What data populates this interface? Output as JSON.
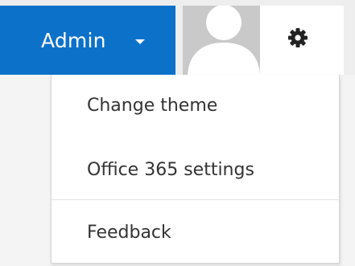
{
  "header": {
    "admin_label": "Admin",
    "admin_icon": "chevron-down-icon",
    "avatar_icon": "user-avatar-icon",
    "settings_icon": "gear-icon"
  },
  "menu": {
    "items": [
      {
        "label": "Change theme"
      },
      {
        "label": "Office 365 settings"
      },
      {
        "label": "Feedback"
      }
    ]
  },
  "colors": {
    "accent": "#0c72c9",
    "menu_text": "#333333",
    "avatar_bg": "#c8c8c8"
  }
}
